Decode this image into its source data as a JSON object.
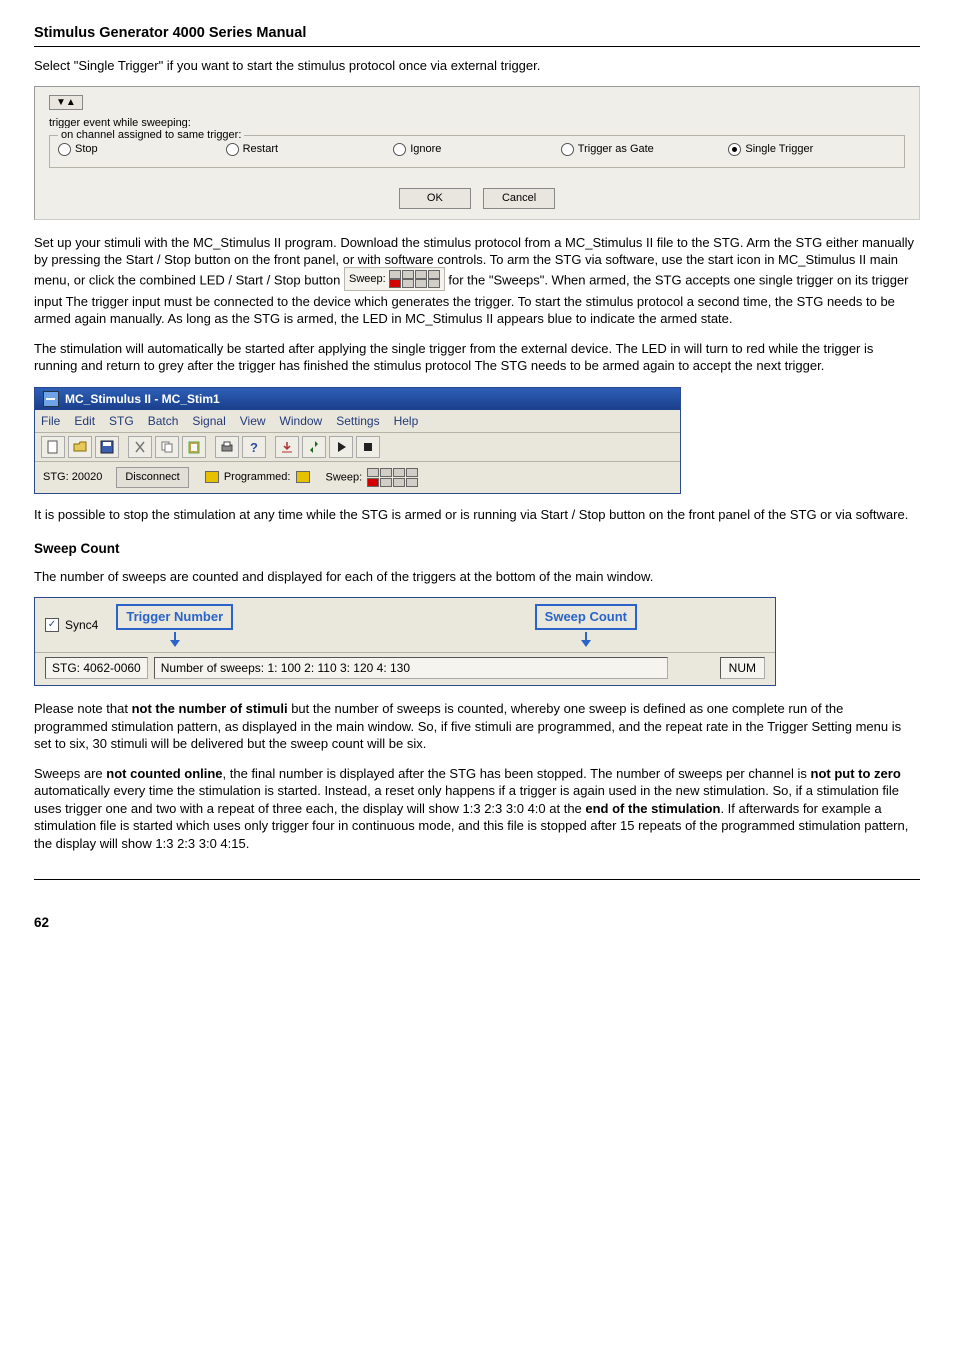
{
  "title": "Stimulus Generator 4000 Series Manual",
  "intro": "Select \"Single Trigger\" if you want to start the stimulus protocol once via external trigger.",
  "dialog": {
    "top_btn": "▼▲",
    "label1": "trigger event while sweeping:",
    "legend": "on channel assigned to same trigger:",
    "opts": {
      "stop": "Stop",
      "restart": "Restart",
      "ignore": "Ignore",
      "gate": "Trigger as Gate",
      "single": "Single Trigger"
    },
    "ok": "OK",
    "cancel": "Cancel"
  },
  "p2a": "Set up your stimuli with the MC_Stimulus II program. Download the stimulus protocol from a MC_Stimulus II file to the STG. Arm the STG either manually by pressing the Start / Stop button on the front panel, or with software controls. To arm the STG via software, use the start icon",
  "p2b": "in MC_Stimulus II main menu, or click the combined LED / Start / Stop button ",
  "p2c": " for the \"Sweeps\". When armed, the STG accepts one single trigger on its trigger input The trigger input must be connected to the device which generates the trigger. To start the stimulus protocol a second time, the STG needs to be armed again manually. As long as the STG is armed, the LED in MC_Stimulus II appears blue to indicate the armed state.",
  "sweep_label": "Sweep:",
  "p3": "The stimulation will automatically be started after applying the single trigger from the external device. The LED in will turn to red while the trigger is running and return to grey after the trigger has finished the stimulus protocol The STG needs to be armed again to accept the next trigger.",
  "stim": {
    "title": "MC_Stimulus II - MC_Stim1",
    "menus": [
      "File",
      "Edit",
      "STG",
      "Batch",
      "Signal",
      "View",
      "Window",
      "Settings",
      "Help"
    ],
    "status_stg": "STG: 20020",
    "disconnect": "Disconnect",
    "programmed": "Programmed:",
    "sweep": "Sweep:"
  },
  "p4": "It is possible to stop the stimulation at any time while the STG is armed or is running via Start / Stop button on the front panel of the STG or via software.",
  "sweep_count_heading": "Sweep Count",
  "p5": "The number of sweeps are counted and displayed for each of the triggers at the bottom of the main window.",
  "sc": {
    "sync": "Sync4",
    "t_label": "Trigger Number",
    "s_label": "Sweep Count",
    "stg": "STG: 4062-0060",
    "sweeps_text": "Number of sweeps: 1: 100 2: 110 3: 120 4: 130",
    "num": "NUM"
  },
  "p6a": "Please note that ",
  "p6b": "not the number of stimuli",
  "p6c": " but the number of sweeps is counted, whereby one sweep is defined as one complete run of the programmed stimulation pattern, as displayed in the main window. So, if five stimuli are programmed, and the repeat rate in the Trigger Setting menu is set to six, 30 stimuli will be delivered but the sweep count will be six.",
  "p7a": "Sweeps are ",
  "p7b": "not counted online",
  "p7c": ", the final number is displayed after the STG has been stopped. The number of sweeps per channel is ",
  "p7d": "not put to zero",
  "p7e": " automatically every time the stimulation is started. Instead, a reset only happens if a trigger is again used in the new stimulation. So, if a stimulation file uses trigger one and two with a repeat of three each, the display will show 1:3 2:3 3:0 4:0 at the ",
  "p7f": "end of the stimulation",
  "p7g": ". If afterwards for example a stimulation file is started which uses only trigger four in continuous mode, and this file is stopped after 15 repeats of the programmed stimulation pattern, the display will show 1:3 2:3 3:0 4:15.",
  "page": "62"
}
